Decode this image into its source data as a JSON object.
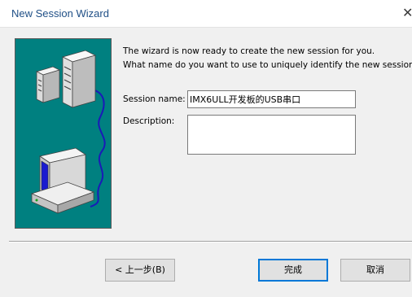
{
  "window": {
    "title": "New Session Wizard",
    "close_glyph": "✕"
  },
  "intro": {
    "line1": "The wizard is now ready to create the new session for you.",
    "line2": "What name do you want to use to uniquely identify the new session?"
  },
  "form": {
    "session_name_label": "Session name:",
    "session_name_value": "IMX6ULL开发板的USB串口",
    "description_label": "Description:",
    "description_value": ""
  },
  "buttons": {
    "back": "< 上一步(B)",
    "finish": "完成",
    "cancel": "取消"
  },
  "colors": {
    "art_background": "#008080",
    "title_text": "#1f4f86",
    "default_button_border": "#0078d7"
  },
  "icons": {
    "art": "network-computers-illustration",
    "close": "close-icon"
  }
}
